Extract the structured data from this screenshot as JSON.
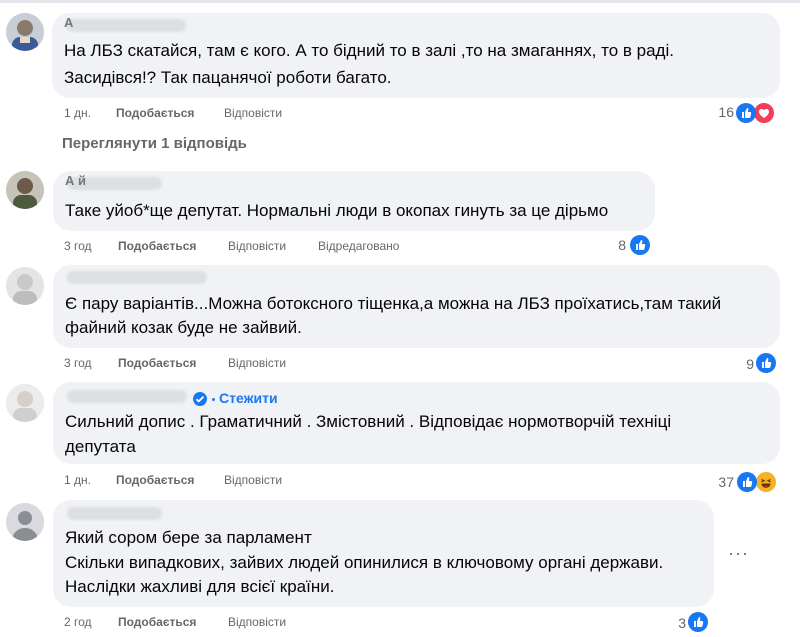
{
  "comments": [
    {
      "author_hint": "А",
      "lines": [
        "На ЛБЗ скатайся, там є кого. А то бідний то в залі ,то на змаганнях, то в раді.",
        "Засидівся!? Так пацанячої роботи багато."
      ],
      "time": "1 дн.",
      "like_label": "Подобається",
      "reply_label": "Відповісти",
      "reaction_count": "16",
      "reactions": [
        "like-icon",
        "love-icon"
      ]
    },
    {
      "author_hint": "А                      й",
      "lines": [
        "Таке уйоб*ще депутат. Нормальні люди в окопах гинуть за це дірьмо"
      ],
      "time": "3 год",
      "like_label": "Подобається",
      "reply_label": "Відповісти",
      "edited_label": "Відредаговано",
      "reaction_count": "8",
      "reactions": [
        "like-icon"
      ]
    },
    {
      "author_hint": "",
      "lines": [
        "Є пару варіантів...Можна ботоксного тіщенка,а можна на ЛБЗ проїхатись,там такий",
        "файний козак буде не зайвий."
      ],
      "time": "3 год",
      "like_label": "Подобається",
      "reply_label": "Відповісти",
      "reaction_count": "9",
      "reactions": [
        "like-icon"
      ]
    },
    {
      "author_hint": "",
      "follow_label": "Стежити",
      "lines": [
        "Сильний допис . Граматичний . Змістовний . Відповідає нормотворчій техніці",
        "депутата"
      ],
      "time": "1 дн.",
      "like_label": "Подобається",
      "reply_label": "Відповісти",
      "reaction_count": "37",
      "reactions": [
        "like-icon",
        "haha-icon"
      ]
    },
    {
      "author_hint": "",
      "lines": [
        "Який сором бере за парламент",
        "Скільки випадкових, зайвих людей опинилися в ключовому органі держави.",
        "Наслідки жахливі для всієї країни."
      ],
      "time": "2 год",
      "like_label": "Подобається",
      "reply_label": "Відповісти",
      "reaction_count": "3",
      "reactions": [
        "like-icon"
      ]
    }
  ],
  "view_replies_label": "Переглянути 1 відповідь",
  "more_label": "···",
  "colors": {
    "bubble": "#f0f2f5",
    "meta_text": "#65676b",
    "link_blue": "#1877f2",
    "love_red": "#f33e58",
    "haha_yellow": "#f7b125"
  }
}
